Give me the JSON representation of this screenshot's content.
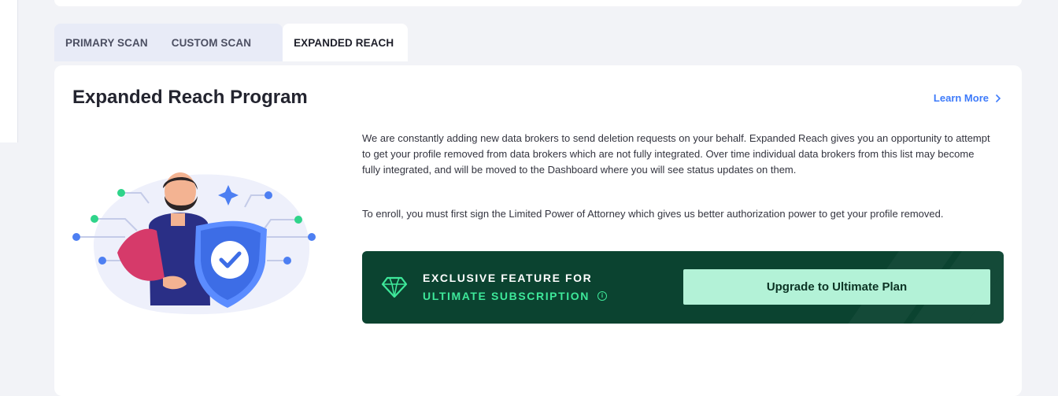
{
  "tabs": [
    {
      "label": "PRIMARY SCAN",
      "active": false
    },
    {
      "label": "CUSTOM SCAN",
      "active": false
    },
    {
      "label": "EXPANDED REACH",
      "active": true
    }
  ],
  "panel": {
    "title": "Expanded Reach Program",
    "learn_more": "Learn More",
    "description_1": "We are constantly adding new data brokers to send deletion requests on your behalf. Expanded Reach gives you an opportunity to attempt to get your profile removed from data brokers which are not fully integrated. Over time individual data brokers from this list may become fully integrated, and will be moved to the Dashboard where you will see status updates on them.",
    "description_2": "To enroll, you must first sign the Limited Power of Attorney which gives us better authorization power to get your profile removed."
  },
  "promo": {
    "line_1": "EXCLUSIVE FEATURE FOR",
    "line_2": "ULTIMATE SUBSCRIPTION",
    "button_label": "Upgrade to Ultimate Plan",
    "icons": [
      "diamond-icon",
      "info-icon"
    ]
  },
  "colors": {
    "accent_blue": "#3e7bfa",
    "promo_bg": "#0b4330",
    "promo_green": "#3ee89a",
    "button_bg": "#b3f2d7",
    "tab_inactive_bg": "#e8ebf7"
  }
}
